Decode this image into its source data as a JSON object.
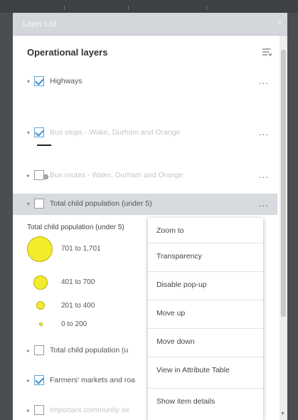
{
  "window": {
    "title": "Layer List",
    "close_label": "×"
  },
  "panel": {
    "title": "Operational layers"
  },
  "layers": [
    {
      "label": "Highways",
      "checked": true,
      "faded": false
    },
    {
      "label": "Bus stops - Wake, Durham and Orange",
      "checked": true,
      "faded": true
    },
    {
      "label": "Bus routes - Wake, Durham and Orange",
      "checked": false,
      "faded": true
    },
    {
      "label": "Total child population (under 5)",
      "checked": false,
      "faded": false
    },
    {
      "label": "Total child population (u",
      "checked": false,
      "faded": false
    },
    {
      "label": "Farmers' markets and roa",
      "checked": true,
      "faded": false
    },
    {
      "label": "Important community se",
      "checked": false,
      "faded": true
    }
  ],
  "options_label": "...",
  "legend": {
    "title": "Total child population (under 5)",
    "classes": [
      {
        "label": "701 to 1,701"
      },
      {
        "label": "401 to 700"
      },
      {
        "label": "201 to 400"
      },
      {
        "label": "0 to 200"
      }
    ]
  },
  "context_menu": {
    "items": [
      "Zoom to",
      "Transparency",
      "Disable pop-up",
      "Move up",
      "Move down",
      "View in Attribute Table",
      "Show item details"
    ]
  },
  "icons": {
    "expand": "expand-icon",
    "options": "more-options-icon",
    "list_options": "list-options-icon"
  },
  "colors": {
    "checkbox_accent": "#3d8fd1",
    "legend_fill": "#f3ec2a",
    "selected_row": "#d7dadf"
  }
}
